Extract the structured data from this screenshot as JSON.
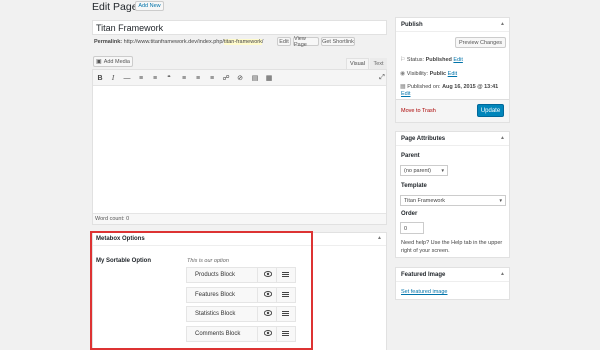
{
  "header": {
    "title": "Edit Page",
    "add_new": "Add New"
  },
  "post": {
    "title": "Titan Framework"
  },
  "permalink": {
    "label": "Permalink:",
    "base": "http://www.titanframework.dev/index.php/",
    "slug": "titan-framework",
    "trail": "/",
    "edit": "Edit",
    "view": "View Page",
    "shortlink": "Get Shortlink"
  },
  "editor": {
    "add_media": "Add Media",
    "tab_visual": "Visual",
    "tab_text": "Text",
    "word_count": "Word count: 0",
    "toolbar": [
      "bold-icon",
      "italic-icon",
      "hr-icon",
      "bullet-list-icon",
      "numbered-list-icon",
      "quote-icon",
      "align-left-icon",
      "align-center-icon",
      "align-right-icon",
      "link-icon",
      "unlink-icon",
      "more-tag-icon",
      "kitchen-sink-icon"
    ]
  },
  "metabox": {
    "title": "Metabox Options",
    "option_label": "My Sortable Option",
    "description": "This is our option",
    "items": [
      {
        "label": "Products Block"
      },
      {
        "label": "Features Block"
      },
      {
        "label": "Statistics Block"
      },
      {
        "label": "Comments Block"
      }
    ]
  },
  "publish": {
    "title": "Publish",
    "preview": "Preview Changes",
    "status_label": "Status:",
    "status_value": "Published",
    "status_edit": "Edit",
    "visibility_label": "Visibility:",
    "visibility_value": "Public",
    "visibility_edit": "Edit",
    "published_on_label": "Published on:",
    "published_on_value": "Aug 16, 2015 @ 13:41",
    "published_edit": "Edit",
    "trash": "Move to Trash",
    "update": "Update"
  },
  "attributes": {
    "title": "Page Attributes",
    "parent_label": "Parent",
    "parent_value": "(no parent)",
    "template_label": "Template",
    "template_value": "Titan Framework",
    "order_label": "Order",
    "order_value": "0",
    "help": "Need help? Use the Help tab in the upper right of your screen."
  },
  "featured": {
    "title": "Featured Image",
    "set_link": "Set featured image"
  },
  "colors": {
    "highlight": "#dd3333",
    "primary": "#0085ba",
    "link": "#0073aa",
    "trash": "#a00"
  }
}
